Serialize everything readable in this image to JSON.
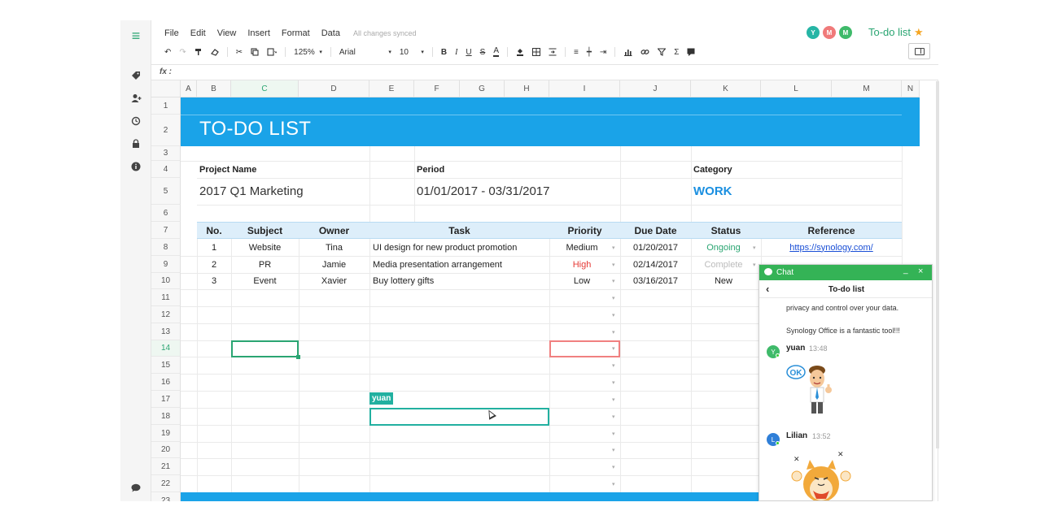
{
  "menu": {
    "items": [
      "File",
      "Edit",
      "View",
      "Insert",
      "Format",
      "Data"
    ],
    "synced_status": "All changes synced"
  },
  "header": {
    "doc_title": "To-do list",
    "collaborators": [
      {
        "initial": "Y",
        "color": "#26b5a5"
      },
      {
        "initial": "M",
        "color": "#f07a7a"
      },
      {
        "initial": "M",
        "color": "#3fba6a"
      }
    ]
  },
  "toolbar": {
    "zoom": "125%",
    "font": "Arial",
    "font_size": "10"
  },
  "formula_bar": {
    "label": "fx",
    "value": ""
  },
  "columns": [
    "A",
    "B",
    "C",
    "D",
    "E",
    "F",
    "G",
    "H",
    "I",
    "J",
    "K",
    "L",
    "M",
    "N"
  ],
  "rows": [
    "1",
    "2",
    "3",
    "4",
    "5",
    "6",
    "7",
    "8",
    "9",
    "10",
    "11",
    "12",
    "13",
    "14",
    "15",
    "16",
    "17",
    "18",
    "19",
    "20",
    "21",
    "22",
    "23"
  ],
  "sheet": {
    "banner_title": "TO-DO LIST",
    "project_label": "Project Name",
    "project_value": "2017 Q1 Marketing",
    "period_label": "Period",
    "period_value": "01/01/2017 - 03/31/2017",
    "category_label": "Category",
    "category_value": "WORK",
    "table_headers": [
      "No.",
      "Subject",
      "Owner",
      "Task",
      "Priority",
      "Due Date",
      "Status",
      "Reference"
    ],
    "tasks": [
      {
        "no": "1",
        "subject": "Website",
        "owner": "Tina",
        "task": "UI design for new product promotion",
        "priority": "Medium",
        "due": "01/20/2017",
        "status": "Ongoing",
        "reference": "https://synology.com/"
      },
      {
        "no": "2",
        "subject": "PR",
        "owner": "Jamie",
        "task": "Media presentation arrangement",
        "priority": "High",
        "due": "02/14/2017",
        "status": "Complete",
        "reference": ""
      },
      {
        "no": "3",
        "subject": "Event",
        "owner": "Xavier",
        "task": "Buy lottery gifts",
        "priority": "Low",
        "due": "03/16/2017",
        "status": "New",
        "reference": ""
      }
    ],
    "remote_cursor_user": "yuan"
  },
  "colors": {
    "banner": "#1aa3e8",
    "accent_green": "#2aa572",
    "link": "#1a4fd6",
    "priority_high": "#e53935",
    "status_ongoing": "#2aa572",
    "status_complete": "#bbbbbb",
    "category_work": "#1a8fe0"
  },
  "chat": {
    "header_label": "Chat",
    "conversation_title": "To-do list",
    "messages_text": [
      "privacy and control over your data.",
      "Synology Office is a fantastic tool!!!"
    ],
    "entries": [
      {
        "initial": "Y",
        "name": "yuan",
        "time": "13:48",
        "color": "#3fba6a",
        "sticker": "OK"
      },
      {
        "initial": "L",
        "name": "Lilian",
        "time": "13:52",
        "color": "#2f7fd8"
      }
    ]
  }
}
